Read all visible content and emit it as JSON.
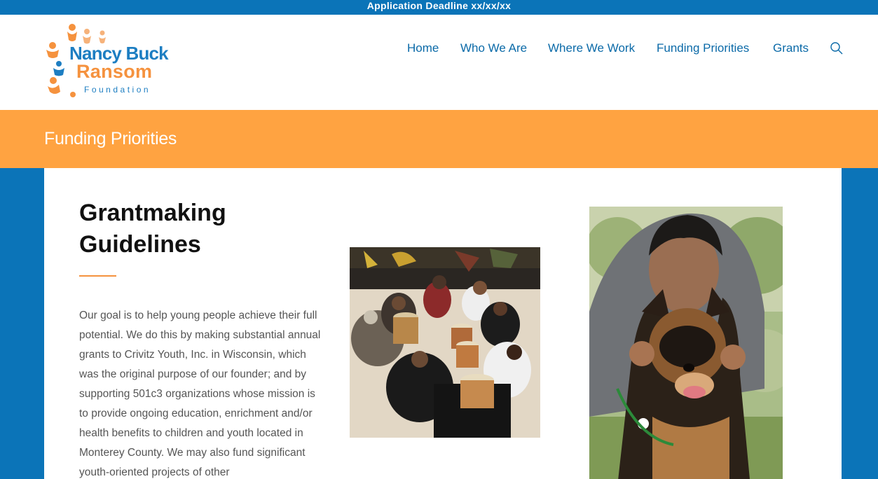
{
  "announcement": "Application Deadline xx/xx/xx",
  "logo": {
    "line1": "Nancy Buck",
    "line2": "Ransom",
    "line3": "Foundation"
  },
  "nav": {
    "items": [
      "Home",
      "Who We Are",
      "Where We Work",
      "Funding Priorities",
      "Grants"
    ],
    "search_icon": "search-icon"
  },
  "page_title": "Funding Priorities",
  "main": {
    "heading": "Grantmaking Guidelines",
    "body": "Our goal is to help young people achieve their full potential.  We do this by making substantial annual grants to Crivitz Youth, Inc. in Wisconsin, which was the original purpose of our founder; and by supporting 501c3 organizations whose mission is to provide ongoing education, enrichment and/or health benefits to children and youth located in Monterey County. We may also fund significant youth-oriented projects of other"
  },
  "colors": {
    "brand_blue": "#0b74b8",
    "accent_orange": "#ffa341",
    "nav_text": "#0b6aa8"
  }
}
